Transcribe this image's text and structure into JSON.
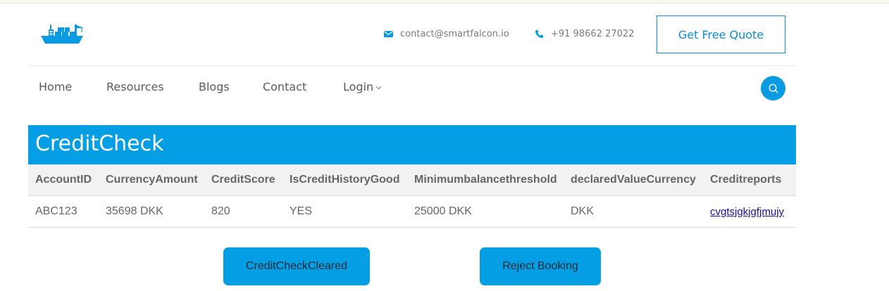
{
  "header": {
    "logo_icon": "cargo-ship-logo-icon",
    "email": "contact@smartfalcon.io",
    "phone": "+91 98662 27022",
    "quote_label": "Get Free Quote",
    "accent_color": "#039ee3"
  },
  "nav": {
    "items": [
      {
        "label": "Home"
      },
      {
        "label": "Resources"
      },
      {
        "label": "Blogs"
      },
      {
        "label": "Contact"
      },
      {
        "label": "Login"
      }
    ],
    "search_icon": "search-icon"
  },
  "panel": {
    "title": "CreditCheck",
    "columns": [
      "AccountID",
      "CurrencyAmount",
      "CreditScore",
      "IsCreditHistoryGood",
      "Minimumbalancethreshold",
      "declaredValueCurrency",
      "Creditreports"
    ],
    "rows": [
      [
        "ABC123",
        "35698 DKK",
        "820",
        "YES",
        "25000 DKK",
        "DKK",
        "cvgtsjgkjgfjmujy"
      ]
    ]
  },
  "actions": {
    "clear_label": "CreditCheckCleared",
    "reject_label": "Reject Booking"
  }
}
